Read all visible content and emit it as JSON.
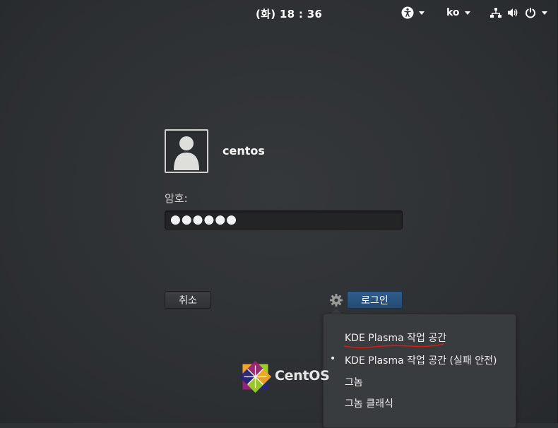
{
  "topbar": {
    "clock": "(화) 18 : 36",
    "language": "ko",
    "accessibility_icon": "accessibility-icon",
    "network_icon": "network-icon",
    "volume_icon": "volume-icon",
    "power_icon": "power-icon"
  },
  "login": {
    "username": "centos",
    "password_label": "암호:",
    "password_value": "●●●●●●",
    "cancel_label": "취소",
    "login_label": "로그인",
    "avatar_icon": "user-avatar-icon",
    "session_icon": "gear-icon"
  },
  "session_menu": {
    "items": [
      {
        "label": "KDE Plasma 작업 공간",
        "selected": false
      },
      {
        "label": "KDE Plasma 작업 공간 (실패 안전)",
        "selected": true
      },
      {
        "label": "그놈",
        "selected": false
      },
      {
        "label": "그놈 클래식",
        "selected": false
      }
    ],
    "bullet": "•",
    "annotation_color": "#e01515"
  },
  "branding": {
    "logo_text": "CentOS"
  }
}
